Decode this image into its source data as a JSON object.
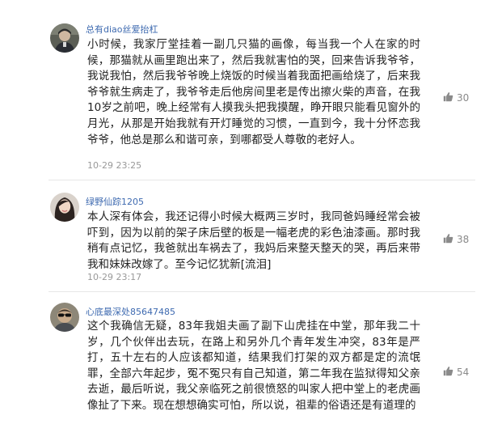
{
  "comments": [
    {
      "username": "总有diao丝爱抬杠",
      "text": "小时候，我家厅堂挂着一副几只猫的画像，每当我一个人在家的时候，那猫就从画里跑出来了，然后我就害怕的哭，回来告诉我爷爷，我说我怕，然后我爷爷晚上烧饭的时候当着我面把画给烧了，后来我爷爷就生病走了，我爷爷走后他房间里老是传出擦火柴的声音，在我10岁之前吧，晚上经常有人摸我头把我摸醒，睁开眼只能看见窗外的月光，从那是开始我就有开灯睡觉的习惯，一直到今，我十分怀恋我爷爷，他总是那么和谐可亲，到哪都受人尊敬的老好人。",
      "time": "10-29 23:25",
      "likes": "30",
      "avatar_icon": "user-avatar-man-icon"
    },
    {
      "username": "绿野仙踪1205",
      "text": "本人深有体会，我还记得小时候大概两三岁时，我同爸妈睡经常会被吓到，因为以前的架子床后壁的板是一幅老虎的彩色油漆画。那时我稍有点记忆，我爸就出车祸去了，我妈后来整天整天的哭，再后来带我和妹妹改嫁了。至今记忆犹新[流泪]",
      "time": "10-29 23:17",
      "likes": "38",
      "avatar_icon": "user-avatar-woman-icon"
    },
    {
      "username": "心底最深处85647485",
      "text": "这个我确信无疑，83年我姐夫画了副下山虎挂在中堂，那年我二十岁，几个伙伴出去玩，在路上和另外几个青年发生冲突，83年是严打，五十左右的人应该都知道，结果我们打架的双方都是定的流氓罪，全部六年起步，冤不冤只有自己知道，第二年我在监狱得知父亲去逝，最后听说，我父亲临死之前很愤怒的叫家人把中堂上的老虎画像扯了下来。现在想想确实可怕，所以说，祖辈的俗语还是有道理的",
      "time": "",
      "likes": "54",
      "avatar_icon": "user-avatar-sunglasses-icon"
    }
  ],
  "colors": {
    "username": "#3e6ab0",
    "body_text": "#222222",
    "meta_text": "#999999",
    "like_icon": "#8a8a8a",
    "divider": "#e6e6e6"
  },
  "icons": {
    "like": "thumbs-up-icon"
  }
}
